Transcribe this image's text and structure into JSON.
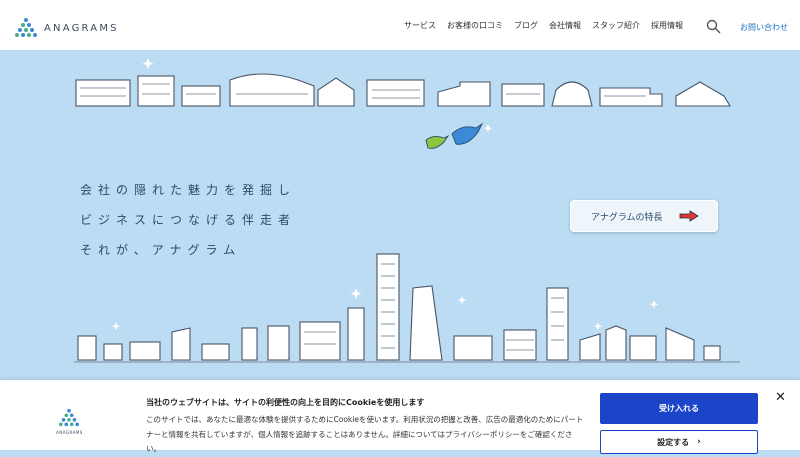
{
  "brand": {
    "name": "ANAGRAMS"
  },
  "nav": {
    "items": [
      "サービス",
      "お客様の口コミ",
      "ブログ",
      "会社情報",
      "スタッフ紹介",
      "採用情報"
    ],
    "contact": "お問い合わせ"
  },
  "hero": {
    "lines": [
      "会社の隠れた魅力を発掘し",
      "ビジネスにつなげる伴走者",
      "それが、アナグラム"
    ],
    "cta_label": "アナグラムの特長"
  },
  "cookie": {
    "title": "当社のウェブサイトは、サイトの利便性の向上を目的にCookieを使用します",
    "body": "このサイトでは、あなたに最適な体験を提供するためにCookieを使います。利用状況の把握と改善、広告の最適化のためにパートナーと情報を共有していますが、個人情報を追跡することはありません。詳細についてはプライバシーポリシーをご確認ください。",
    "accept_label": "受け入れる",
    "settings_label": "設定する",
    "logo_text": "ANAGRAMS"
  },
  "colors": {
    "sky": "#bcdcf3",
    "accent_blue": "#1b44c8",
    "arrow_red": "#e0353a",
    "link_blue": "#1a73c8"
  }
}
